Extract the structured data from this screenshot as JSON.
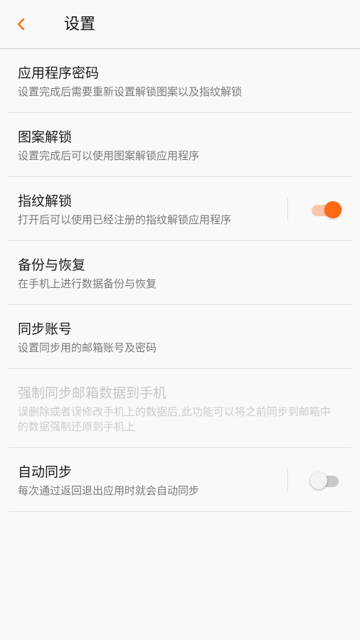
{
  "header": {
    "title": "设置",
    "back_icon": "chevron-left-icon",
    "accent_color": "#ff6a10"
  },
  "settings": [
    {
      "title": "应用程序密码",
      "subtitle": "设置完成后需要重新设置解锁图案以及指纹解锁"
    },
    {
      "title": "图案解锁",
      "subtitle": "设置完成后可以使用图案解锁应用程序"
    },
    {
      "title": "指纹解锁",
      "subtitle": "打开后可以使用已经注册的指纹解锁应用程序",
      "toggle": "on"
    },
    {
      "title": "备份与恢复",
      "subtitle": "在手机上进行数据备份与恢复"
    },
    {
      "title": "同步账号",
      "subtitle": "设置同步用的邮箱账号及密码"
    },
    {
      "title": "强制同步邮箱数据到手机",
      "subtitle": "误删除或者误修改手机上的数据后,此功能可以将之前同步到邮箱中的数据强制还原到手机上",
      "disabled": true
    },
    {
      "title": "自动同步",
      "subtitle": "每次通过返回退出应用时就会自动同步",
      "toggle": "off"
    }
  ]
}
